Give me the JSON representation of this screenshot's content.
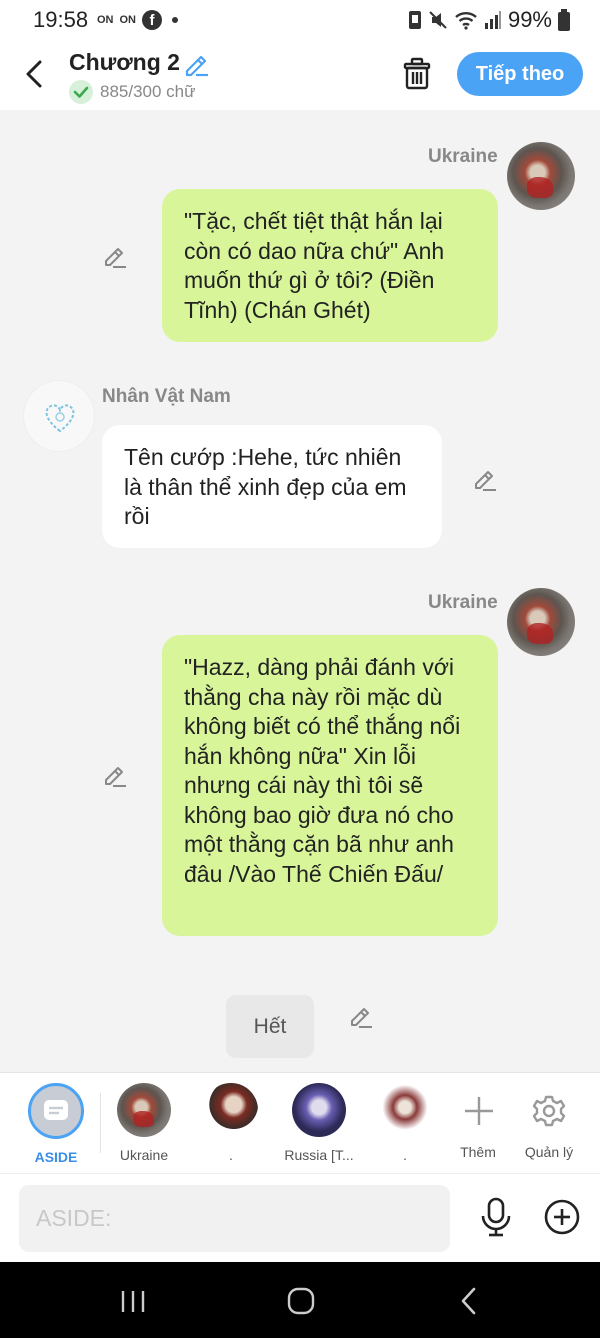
{
  "status_bar": {
    "time": "19:58",
    "n1": "ON",
    "n2": "ON",
    "battery": "99%"
  },
  "header": {
    "title": "Chương 2",
    "word_count": "885/300 chữ",
    "next_label": "Tiếp theo"
  },
  "messages": [
    {
      "speaker": "Ukraine",
      "side": "right",
      "text": "\"Tặc, chết tiệt thật hắn lại còn có dao nữa chứ\" Anh muốn thứ gì ở tôi? (Điền Tĩnh) (Chán Ghét)"
    },
    {
      "speaker": "Nhân Vật Nam",
      "side": "left",
      "text": "Tên cướp :Hehe, tức nhiên là thân thể xinh đẹp của em rồi"
    },
    {
      "speaker": "Ukraine",
      "side": "right",
      "text": "\"Hazz, dàng phải đánh với thằng cha này rồi mặc dù không biết có thể thắng nổi hắn không nữa\" Xin lỗi nhưng cái này thì tôi sẽ không bao giờ đưa nó cho một thằng cặn bã như anh đâu /Vào Thế Chiến Đấu/"
    }
  ],
  "end_label": "Hết",
  "character_bar": {
    "aside": "ASIDE",
    "characters": [
      "Ukraine",
      ".",
      "Russia [T...",
      "."
    ],
    "add": "Thêm",
    "manage": "Quản lý"
  },
  "input": {
    "placeholder": "ASIDE:"
  },
  "colors": {
    "accent": "#4aa3f5",
    "my_bubble": "#d8f59a",
    "other_bubble": "#ffffff"
  }
}
